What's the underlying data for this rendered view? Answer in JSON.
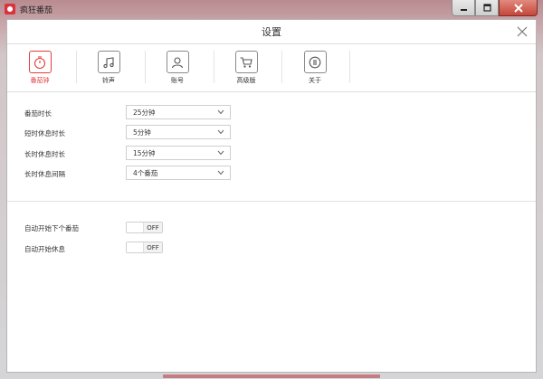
{
  "window": {
    "app_title": "疯狂番茄"
  },
  "dialog": {
    "title": "设置"
  },
  "tabs": [
    {
      "label": "番茄钟",
      "icon": "stopwatch-icon",
      "active": true
    },
    {
      "label": "铃声",
      "icon": "music-note-icon",
      "active": false
    },
    {
      "label": "账号",
      "icon": "user-icon",
      "active": false
    },
    {
      "label": "高级版",
      "icon": "cart-icon",
      "active": false
    },
    {
      "label": "关于",
      "icon": "info-icon",
      "active": false
    }
  ],
  "settings": {
    "pomodoro_length": {
      "label": "番茄时长",
      "value": "25分钟"
    },
    "short_break": {
      "label": "短时休息时长",
      "value": "5分钟"
    },
    "long_break": {
      "label": "长时休息时长",
      "value": "15分钟"
    },
    "long_break_interval": {
      "label": "长时休息间隔",
      "value": "4个番茄"
    }
  },
  "toggles": {
    "auto_start_next": {
      "label": "自动开始下个番茄",
      "state": "OFF"
    },
    "auto_start_break": {
      "label": "自动开始休息",
      "state": "OFF"
    }
  },
  "colors": {
    "accent": "#e23c3c",
    "titlebar": "#b98b8f"
  }
}
